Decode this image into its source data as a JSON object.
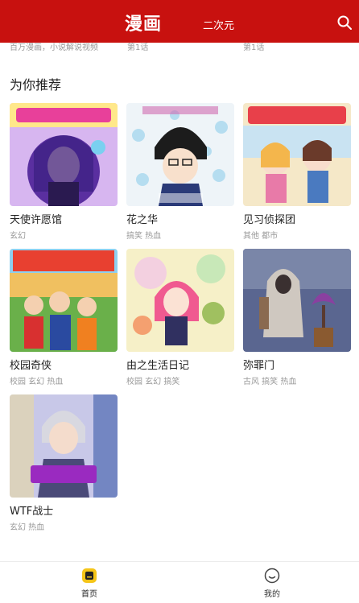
{
  "header": {
    "title": "漫画",
    "tab2": "二次元",
    "bg_color": "#c8110f",
    "search_icon": "search-icon"
  },
  "cutoff_row": [
    "百万漫画，小说解说视频",
    "第1话",
    "第1话"
  ],
  "section": {
    "title": "为你推荐"
  },
  "comics": [
    {
      "name": "天使许愿馆",
      "tags": "玄幻"
    },
    {
      "name": "花之华",
      "tags": "搞笑 热血"
    },
    {
      "name": "见习侦探团",
      "tags": "其他 都市"
    },
    {
      "name": "校园奇侠",
      "tags": "校园 玄幻 热血"
    },
    {
      "name": "由之生活日记",
      "tags": "校园 玄幻 搞笑"
    },
    {
      "name": "弥罪门",
      "tags": "古风 搞笑 热血"
    },
    {
      "name": "WTF战士",
      "tags": "玄幻 热血"
    }
  ],
  "bottom_nav": {
    "home": "首页",
    "mine": "我的",
    "home_icon": "home-icon",
    "mine_icon": "profile-icon",
    "active_color": "#f5c518"
  }
}
